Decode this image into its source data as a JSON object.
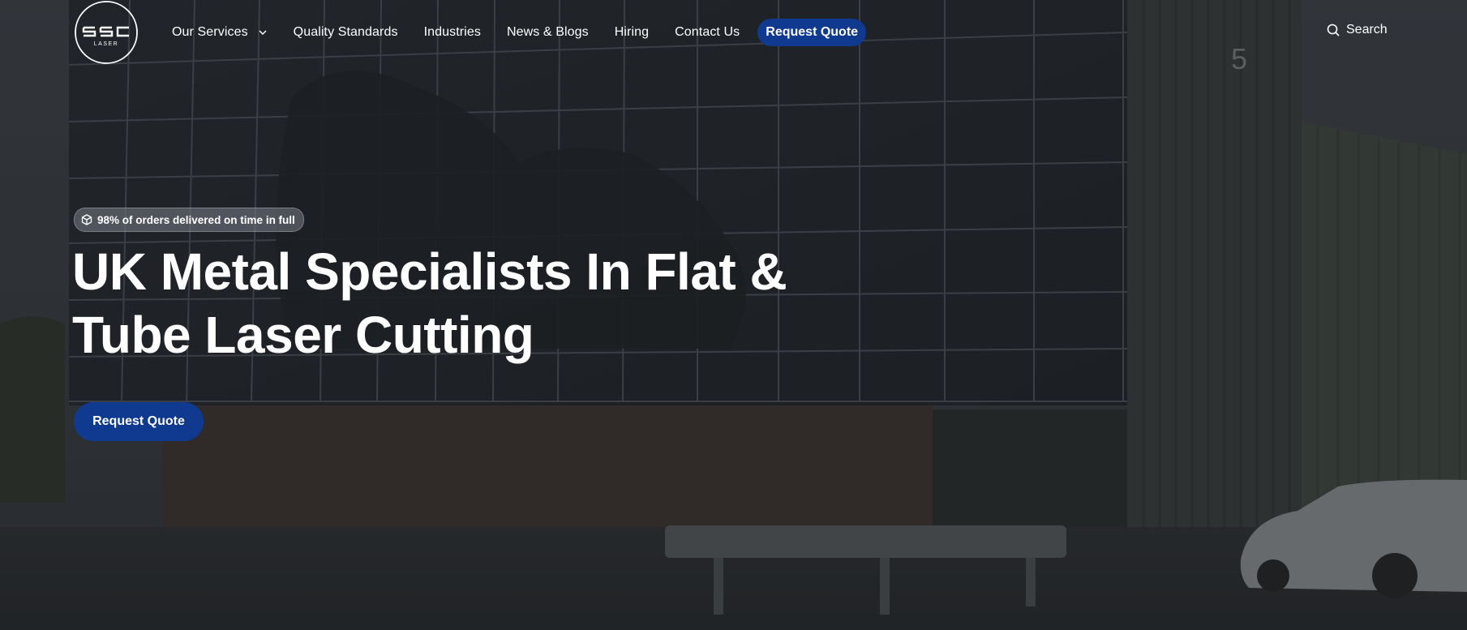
{
  "brand": {
    "logo_text": "SSC",
    "logo_subtext": "LASER",
    "logo_icon": "ssc-laser-logo"
  },
  "nav": {
    "items": [
      {
        "label": "Our Services",
        "has_dropdown": true,
        "icon": "chevron-down-icon"
      },
      {
        "label": "Quality Standards"
      },
      {
        "label": "Industries"
      },
      {
        "label": "News & Blogs"
      },
      {
        "label": "Hiring"
      },
      {
        "label": "Contact Us"
      }
    ],
    "cta_label": "Request Quote",
    "search_label": "Search",
    "search_icon": "search-icon"
  },
  "hero": {
    "badge_text": "98% of orders delivered on time in full",
    "badge_icon": "box-icon",
    "headline_line1": "UK Metal Specialists In Flat &",
    "headline_line2": "Tube Laser Cutting",
    "cta_label": "Request Quote"
  },
  "colors": {
    "accent": "#0f3a8f",
    "overlay": "#1f2226",
    "text": "#ffffff"
  }
}
